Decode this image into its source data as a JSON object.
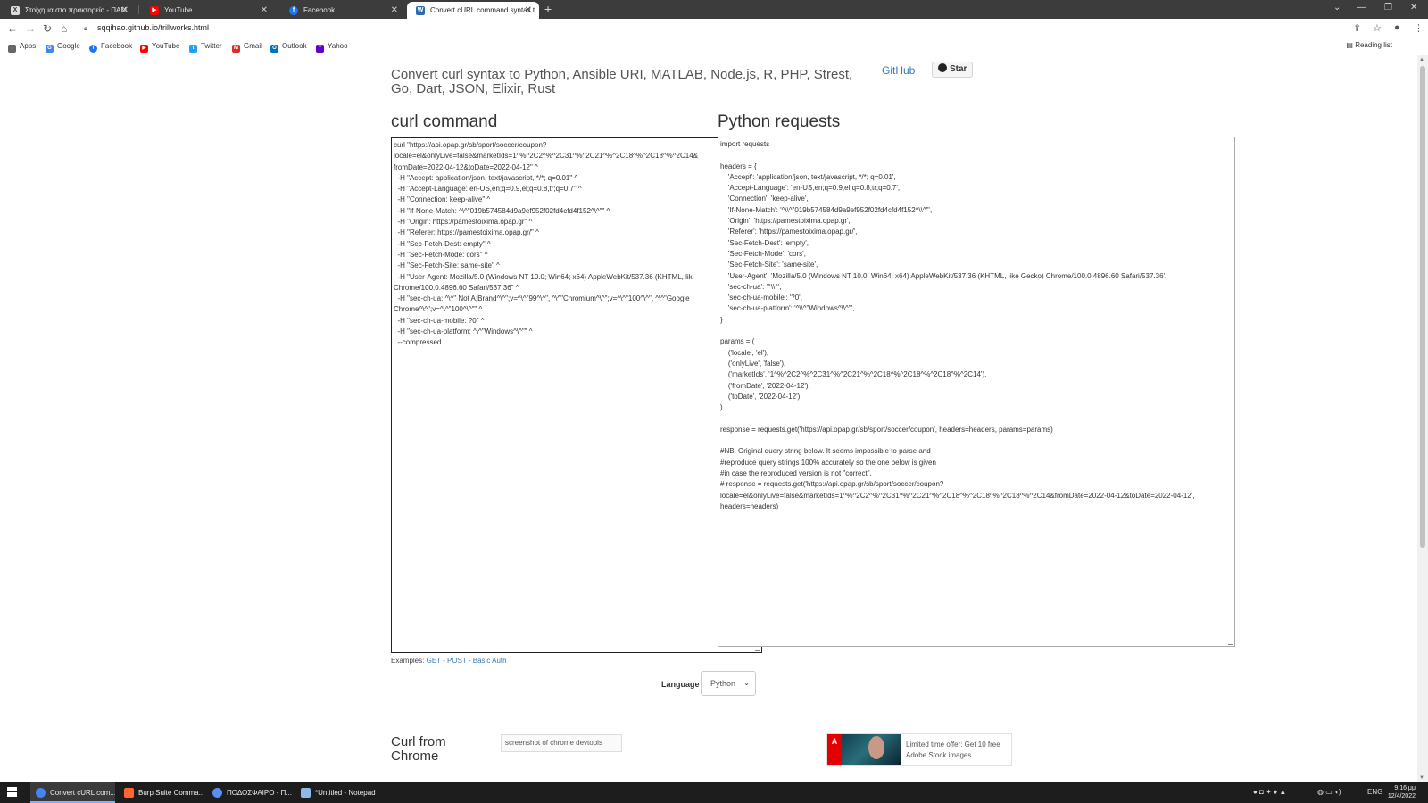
{
  "browser": {
    "tabs": [
      {
        "title": "Στοίχημα στο πρακτορείο - ΠΑΜ",
        "icon": "opap-icon",
        "color": "#e9e9e9"
      },
      {
        "title": "YouTube",
        "icon": "youtube-icon",
        "color": "#ff0000"
      },
      {
        "title": "Facebook",
        "icon": "facebook-icon",
        "color": "#1877f2"
      },
      {
        "title": "Convert cURL command syntax t",
        "icon": "trillworks-icon",
        "color": "#2b6cb0"
      }
    ],
    "url": "sqqihao.github.io/trillworks.html",
    "bookmarks": [
      "Apps",
      "Google",
      "Facebook",
      "YouTube",
      "Twitter",
      "Gmail",
      "Outlook",
      "Yahoo"
    ],
    "reading_list": "Reading list"
  },
  "page": {
    "headline": "Convert curl syntax to Python, Ansible URI, MATLAB, Node.js, R, PHP, Strest, Go, Dart, JSON, Elixir, Rust",
    "github_label": "GitHub",
    "star_label": "Star",
    "curl_title": "curl command",
    "python_title": "Python requests",
    "curl_code": "curl \"https://api.opap.gr/sb/sport/soccer/coupon?\nlocale=el&onlyLive=false&marketIds=1^%^2C2^%^2C31^%^2C21^%^2C18^%^2C18^%^2C14&\nfromDate=2022-04-12&toDate=2022-04-12\" ^\n  -H \"Accept: application/json, text/javascript, */*; q=0.01\" ^\n  -H \"Accept-Language: en-US,en;q=0.9,el;q=0.8,tr;q=0.7\" ^\n  -H \"Connection: keep-alive\" ^\n  -H \"If-None-Match: ^\\^\"019b574584d9a9ef952f02fd4cfd4f152^\\^\"\" ^\n  -H \"Origin: https://pamestoixima.opap.gr\" ^\n  -H \"Referer: https://pamestoixima.opap.gr/\" ^\n  -H \"Sec-Fetch-Dest: empty\" ^\n  -H \"Sec-Fetch-Mode: cors\" ^\n  -H \"Sec-Fetch-Site: same-site\" ^\n  -H \"User-Agent: Mozilla/5.0 (Windows NT 10.0; Win64; x64) AppleWebKit/537.36 (KHTML, lik\nChrome/100.0.4896.60 Safari/537.36\" ^\n  -H \"sec-ch-ua: ^\\^\" Not A;Brand^\\^\";v=^\\^\"99^\\^\", ^\\^\"Chromium^\\^\";v=^\\^\"100^\\^\", ^\\^\"Google\nChrome^\\^\";v=^\\^\"100^\\^\"\" ^\n  -H \"sec-ch-ua-mobile: ?0\" ^\n  -H \"sec-ch-ua-platform: ^\\^\"Windows^\\^\"\" ^\n  --compressed",
    "python_code": "import requests\n\nheaders = {\n    'Accept': 'application/json, text/javascript, */*; q=0.01',\n    'Accept-Language': 'en-US,en;q=0.9,el;q=0.8,tr;q=0.7',\n    'Connection': 'keep-alive',\n    'If-None-Match': '^\\\\^\"019b574584d9a9ef952f02fd4cfd4f152^\\\\^\"',\n    'Origin': 'https://pamestoixima.opap.gr',\n    'Referer': 'https://pamestoixima.opap.gr/',\n    'Sec-Fetch-Dest': 'empty',\n    'Sec-Fetch-Mode': 'cors',\n    'Sec-Fetch-Site': 'same-site',\n    'User-Agent': 'Mozilla/5.0 (Windows NT 10.0; Win64; x64) AppleWebKit/537.36 (KHTML, like Gecko) Chrome/100.0.4896.60 Safari/537.36',\n    'sec-ch-ua': '^\\\\^',\n    'sec-ch-ua-mobile': '?0',\n    'sec-ch-ua-platform': '^\\\\^\"Windows^\\\\^\"',\n}\n\nparams = (\n    ('locale', 'el'),\n    ('onlyLive', 'false'),\n    ('marketIds', '1^%^2C2^%^2C31^%^2C21^%^2C18^%^2C18^%^2C18^%^2C14'),\n    ('fromDate', '2022-04-12'),\n    ('toDate', '2022-04-12'),\n)\n\nresponse = requests.get('https://api.opap.gr/sb/sport/soccer/coupon', headers=headers, params=params)\n\n#NB. Original query string below. It seems impossible to parse and\n#reproduce query strings 100% accurately so the one below is given\n#in case the reproduced version is not \"correct\".\n# response = requests.get('https://api.opap.gr/sb/sport/soccer/coupon?locale=el&onlyLive=false&marketIds=1^%^2C2^%^2C31^%^2C21^%^2C18^%^2C18^%^2C18^%^2C14&fromDate=2022-04-12&toDate=2022-04-12', headers=headers)",
    "examples_label": "Examples:",
    "examples": [
      "GET",
      "POST",
      "Basic Auth"
    ],
    "language_label": "Language",
    "language_value": "Python",
    "curl_chrome_title": "Curl from Chrome",
    "devtools_alt": "screenshot of chrome devtools",
    "ad_text": "Limited time offer: Get 10 free Adobe Stock images."
  },
  "taskbar": {
    "tasks": [
      {
        "label": "Convert cURL com...",
        "color": "#4285f4"
      },
      {
        "label": "Burp Suite Comma...",
        "color": "#ff6633"
      },
      {
        "label": "ΠΟΔΟΣΦΑΙΡΟ - Π...",
        "color": "#5c8df6"
      },
      {
        "label": "*Untitled - Notepad",
        "color": "#8fb9e8"
      }
    ],
    "lang": "ENG",
    "time": "9:16 μμ",
    "date": "12/4/2022"
  }
}
